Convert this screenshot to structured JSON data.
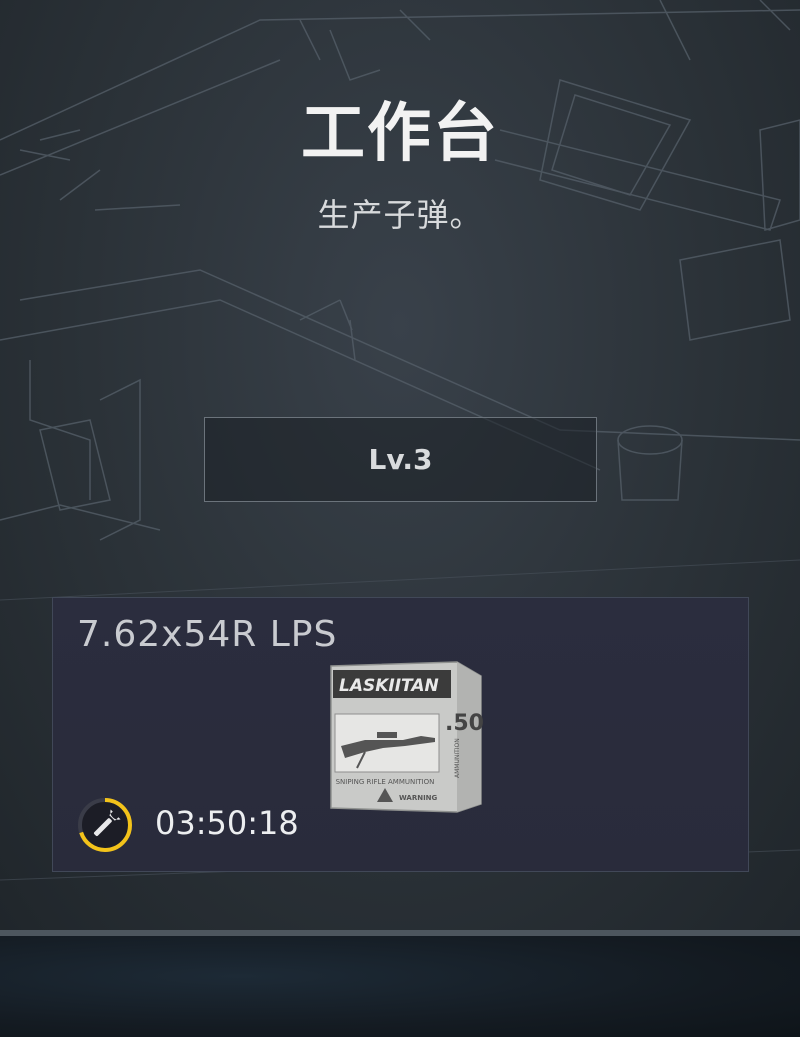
{
  "workbench": {
    "title": "工作台",
    "subtitle": "生产子弹。",
    "level_label": "Lv.3"
  },
  "craft_item": {
    "name": "7.62x54R LPS",
    "timer": "03:50:18",
    "timer_progress": 0.7,
    "box_brand": "LASKIITAN",
    "box_caliber": ".50",
    "box_caption": "SNIPING RIFLE AMMUNITION",
    "box_warning": "WARNING",
    "box_side": "AMMUNITION"
  },
  "colors": {
    "background": "#2b3238",
    "card": "#2a2c3c",
    "timer_ring": "#f3c31a"
  },
  "icons": {
    "timer": "wrench-icon"
  }
}
